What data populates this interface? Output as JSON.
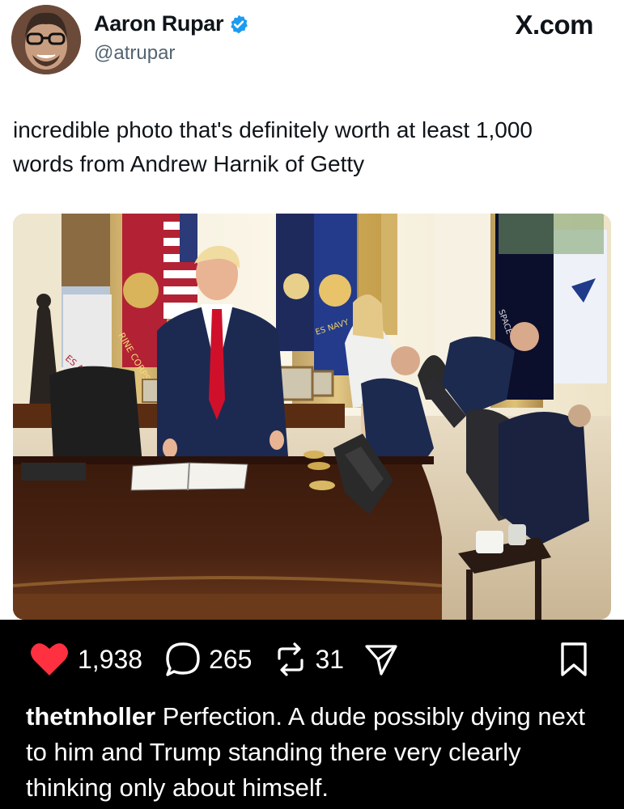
{
  "tweet": {
    "display_name": "Aaron Rupar",
    "handle": "@atrupar",
    "verified": true,
    "source": "X.com",
    "text": "incredible photo that's definitely worth at least 1,000 words from Andrew Harnik of Getty",
    "photo": {
      "flag_text": {
        "army": "ES ARMY",
        "navy": "ES NAVY",
        "space": "SPACE",
        "marine": "RINE CORPS"
      }
    }
  },
  "engagement": {
    "likes": "1,938",
    "replies": "265",
    "reposts": "31"
  },
  "comment": {
    "username": "thetnholler",
    "text": "Perfection. A dude possibly dying next to him and Trump standing there very clearly thinking only about himself."
  },
  "icons": {
    "verified": "verified-badge-icon",
    "like": "heart-icon",
    "reply": "speech-bubble-icon",
    "repost": "repost-arrows-icon",
    "share": "send-icon",
    "bookmark": "bookmark-icon"
  },
  "colors": {
    "verified": "#1d9bf0",
    "like": "#ff3040",
    "dark_bar": "#000000",
    "handle": "#536471"
  }
}
